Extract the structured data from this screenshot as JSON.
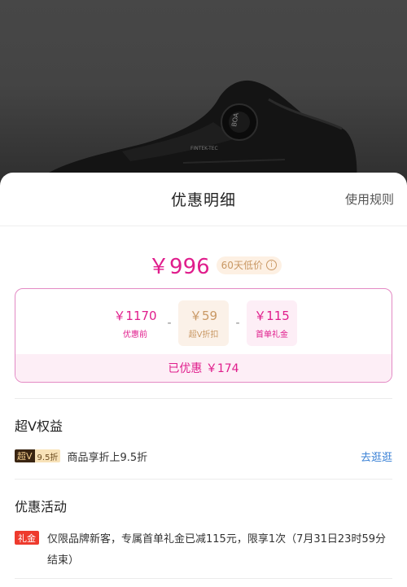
{
  "product": {
    "tech_label": "FINTEK-TEC",
    "dial_label": "BOA"
  },
  "sheet": {
    "title": "优惠明细",
    "rules_link": "使用规则"
  },
  "price": {
    "final": "￥996",
    "low_badge": "60天低价",
    "info_icon": "info-icon"
  },
  "breakdown": {
    "items": [
      {
        "amount": "￥1170",
        "label": "优惠前"
      },
      {
        "amount": "￥59",
        "label": "超V折扣"
      },
      {
        "amount": "￥115",
        "label": "首单礼金"
      }
    ],
    "operators": [
      "-",
      "-"
    ],
    "saved": "已优惠 ￥174"
  },
  "super_v": {
    "title": "超V权益",
    "badge_left": "超V",
    "badge_right": "9.5折",
    "text": "商品享折上9.5折",
    "link": "去逛逛"
  },
  "promo": {
    "title": "优惠活动",
    "tag": "礼金",
    "text": "仅限品牌新客，专属首单礼金已减115元，限享1次（7月31日23时59分结束）"
  },
  "colors": {
    "accent": "#e01d8c",
    "super_v_gold": "#c99864",
    "link_blue": "#3b82d6",
    "gift_red": "#ee3a2d"
  }
}
